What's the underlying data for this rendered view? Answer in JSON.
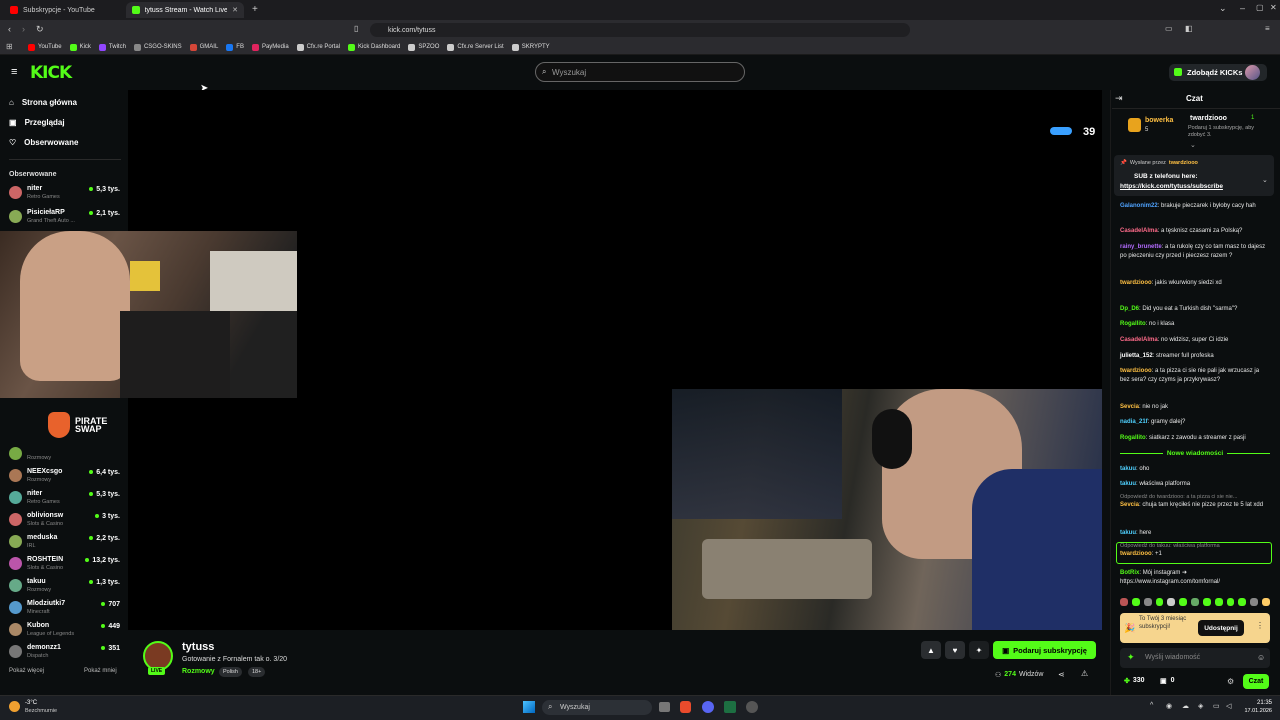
{
  "browser": {
    "tabs": [
      {
        "title": "Subskrypcje - YouTube",
        "color": "#ff0000"
      },
      {
        "title": "tytuss Stream - Watch Live on Ki",
        "color": "#53fc18"
      }
    ],
    "url": "kick.com/tytuss",
    "bookmarks": [
      {
        "label": "YouTube",
        "color": "#ff0000"
      },
      {
        "label": "Kick",
        "color": "#53fc18"
      },
      {
        "label": "Twitch",
        "color": "#9146ff"
      },
      {
        "label": "CSGO-SKINS",
        "color": "#888888"
      },
      {
        "label": "GMAIL",
        "color": "#d44638"
      },
      {
        "label": "FB",
        "color": "#1877f2"
      },
      {
        "label": "PayMedia",
        "color": "#e0245e"
      },
      {
        "label": "Cfx.re Portal",
        "color": "#cccccc"
      },
      {
        "label": "Kick Dashboard",
        "color": "#53fc18"
      },
      {
        "label": "SPZOO",
        "color": "#cccccc"
      },
      {
        "label": "Cfx.re Server List",
        "color": "#cccccc"
      },
      {
        "label": "SKRYPTY",
        "color": "#cccccc"
      }
    ]
  },
  "header": {
    "logo": "KICK",
    "search_placeholder": "Wyszukaj",
    "kicks_button": "Zdobądź KICKs"
  },
  "sidebar": {
    "nav": [
      {
        "label": "Strona główna",
        "icon": "home-icon"
      },
      {
        "label": "Przeglądaj",
        "icon": "browse-icon"
      },
      {
        "label": "Obserwowane",
        "icon": "heart-icon"
      }
    ],
    "followed_title": "Obserwowane",
    "channels_top": [
      {
        "name": "niter",
        "category": "Retro Games",
        "viewers": "5,3 tys."
      },
      {
        "name": "PisiciełaRP",
        "category": "Grand Theft Auto ...",
        "viewers": "2,1 tys."
      }
    ],
    "ad_text": "PIRATE SWAP",
    "channels_bottom": [
      {
        "name": "",
        "category": "Rozmowy",
        "viewers": ""
      },
      {
        "name": "NEEXcsgo",
        "category": "Rozmowy",
        "viewers": "6,4 tys."
      },
      {
        "name": "niter",
        "category": "Retro Games",
        "viewers": "5,3 tys."
      },
      {
        "name": "oblivionsw",
        "category": "Slots & Casino",
        "viewers": "3 tys."
      },
      {
        "name": "meduska",
        "category": "IRL",
        "viewers": "2,2 tys."
      },
      {
        "name": "ROSHTEIN",
        "category": "Slots & Casino",
        "viewers": "13,2 tys."
      },
      {
        "name": "takuu",
        "category": "Rozmowy",
        "viewers": "1,3 tys."
      },
      {
        "name": "Mlodziutki7",
        "category": "Minecraft",
        "viewers": "707"
      },
      {
        "name": "Kubon",
        "category": "League of Legends",
        "viewers": "449"
      },
      {
        "name": "demonzz1",
        "category": "Dispatch",
        "viewers": "351"
      }
    ],
    "show_more": "Pokaż więcej",
    "show_less": "Pokaż mniej"
  },
  "player": {
    "overlay_count": "39"
  },
  "stream": {
    "channel": "tytuss",
    "live_badge": "LIVE",
    "title": "Gotowanie z Fornalem tak o. 3/20",
    "category": "Rozmowy",
    "tags": [
      "Polish",
      "18+"
    ],
    "subscribe_button": "Podaruj subskrypcję",
    "viewers": "274",
    "viewers_label": "Widzów"
  },
  "chat": {
    "title": "Czat",
    "leaderboard": {
      "left_name": "bowerka",
      "left_count": "5",
      "right_name": "twardziooo",
      "right_count": "1",
      "right_sub": "Podaruj 1 subskrypcję, aby zdobyć 3."
    },
    "pinned": {
      "by_label": "Wysłane przez",
      "by_user": "twardziooo",
      "text": "SUB z telefonu here:",
      "link": "https://kick.com/tytuss/subscribe"
    },
    "messages": [
      {
        "user": "Galanonim22",
        "color": "#4fa3ff",
        "text": "brakuje pieczarek i byłoby cacy hah"
      },
      {
        "user": "CasadelAlma",
        "color": "#ff6b8a",
        "text": "a tęsknisz czasami za Polską?"
      },
      {
        "user": "rainy_brunette",
        "color": "#b36bff",
        "text": "a ta rukolę czy co tam masz to dajesz po pieczeniu czy przed i pieczesz razem ?"
      },
      {
        "user": "twardziooo",
        "color": "#ffc043",
        "text": "jakis wkurwiony siedzi xd"
      },
      {
        "user": "Dp_D6",
        "color": "#53fc18",
        "text": "Did you eat a Turkish dish \"sarma\"?"
      },
      {
        "user": "Rogallito",
        "color": "#53fc18",
        "text": "no i klasa"
      },
      {
        "user": "CasadelAlma",
        "color": "#ff6b8a",
        "text": "no widzisz, super Ci idzie"
      },
      {
        "user": "julietta_152",
        "color": "#ffffff",
        "text": "streamer full profeska"
      },
      {
        "user": "twardziooo",
        "color": "#ffc043",
        "text": "a ta pizza ci sie nie pali jak wrzucasz ja bez sera? czy czyms ja przykrywasz?"
      },
      {
        "user": "Sevcia",
        "color": "#ffc043",
        "text": "nie no jak"
      },
      {
        "user": "nadia_21f",
        "color": "#4fd1ff",
        "text": "gramy dalej?"
      },
      {
        "user": "Rogallito",
        "color": "#53fc18",
        "text": "siatkarz z zawodu a streamer z pasji"
      }
    ],
    "new_messages_label": "Nowe wiadomości",
    "new_messages": [
      {
        "reply": "",
        "user": "takuu",
        "color": "#4fd1ff",
        "text": "oho"
      },
      {
        "reply": "",
        "user": "takuu",
        "color": "#4fd1ff",
        "text": "właściwa platforma"
      },
      {
        "reply": "Odpowiedź do twardziooo: a ta pizza ci sie nie...",
        "user": "Sevcia",
        "color": "#ffc043",
        "text": "chuja tam kręciłeś nie pizze przez te 5 lat xdd"
      },
      {
        "reply": "",
        "user": "takuu",
        "color": "#4fd1ff",
        "text": "here"
      },
      {
        "reply": "Odpowiedź do takuu: właściwa platforma",
        "user": "twardziooo",
        "color": "#ffc043",
        "text": "+1"
      },
      {
        "reply": "",
        "user": "BotRix",
        "color": "#53fc18",
        "text": "Mój instagram ➜ https://www.instagram.com/tomfornal/"
      }
    ],
    "promo": {
      "text": "To Twój 3 miesiąc subskrypcji!",
      "button": "Udostępnij"
    },
    "input_placeholder": "Wyślij wiadomość",
    "points": "330",
    "gifts": "0",
    "send_button": "Czat"
  },
  "taskbar": {
    "weather_temp": "-3°C",
    "weather_desc": "Bezchmurnie",
    "search_placeholder": "Wyszukaj",
    "time": "21:35",
    "date": "17.01.2026"
  }
}
